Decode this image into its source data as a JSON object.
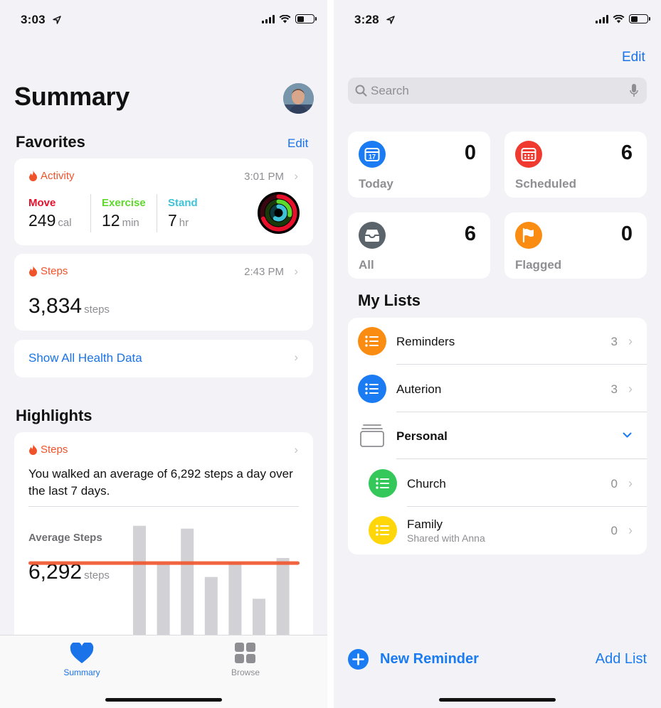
{
  "health": {
    "status": {
      "time": "3:03"
    },
    "title": "Summary",
    "favorites": {
      "heading": "Favorites",
      "edit_label": "Edit",
      "activity": {
        "label": "Activity",
        "time": "3:01 PM",
        "move": {
          "label": "Move",
          "value": "249",
          "unit": "cal",
          "color": "#e8102a"
        },
        "exercise": {
          "label": "Exercise",
          "value": "12",
          "unit": "min",
          "color": "#5ed82a"
        },
        "stand": {
          "label": "Stand",
          "value": "7",
          "unit": "hr",
          "color": "#3ec2d8"
        }
      },
      "steps": {
        "label": "Steps",
        "time": "2:43 PM",
        "value": "3,834",
        "unit": "steps"
      },
      "show_all_label": "Show All Health Data"
    },
    "highlights": {
      "heading": "Highlights",
      "steps_label": "Steps",
      "text": "You walked an average of 6,292 steps a day over the last 7 days.",
      "avg_label": "Average Steps",
      "avg_value": "6,292",
      "avg_unit": "steps",
      "daily_values": [
        11500,
        7500,
        11200,
        6100,
        7600,
        3800,
        8100
      ],
      "average": 7600
    },
    "tabs": [
      {
        "label": "Summary",
        "icon": "heart-icon",
        "active": true
      },
      {
        "label": "Browse",
        "icon": "grid-icon",
        "active": false
      }
    ],
    "accent": "#1a73e8"
  },
  "reminders": {
    "status": {
      "time": "3:28"
    },
    "edit_label": "Edit",
    "search": {
      "placeholder": "Search"
    },
    "smart_lists": [
      {
        "label": "Today",
        "count": "0",
        "icon": "calendar-today-icon",
        "color": "#1a7bf2",
        "day": "17"
      },
      {
        "label": "Scheduled",
        "count": "6",
        "icon": "calendar-scheduled-icon",
        "color": "#f03a30"
      },
      {
        "label": "All",
        "count": "6",
        "icon": "tray-icon",
        "color": "#5b636b"
      },
      {
        "label": "Flagged",
        "count": "0",
        "icon": "flag-icon",
        "color": "#fb8c12"
      }
    ],
    "my_lists_heading": "My Lists",
    "lists": [
      {
        "name": "Reminders",
        "count": "3",
        "color": "#fb8c12"
      },
      {
        "name": "Auterion",
        "count": "3",
        "color": "#1a7bf2"
      },
      {
        "name": "Personal",
        "group": true
      },
      {
        "name": "Church",
        "count": "0",
        "color": "#34c759"
      },
      {
        "name": "Family",
        "subtitle": "Shared with Anna",
        "count": "0",
        "color": "#ffd60a"
      }
    ],
    "new_reminder_label": "New Reminder",
    "add_list_label": "Add List"
  }
}
